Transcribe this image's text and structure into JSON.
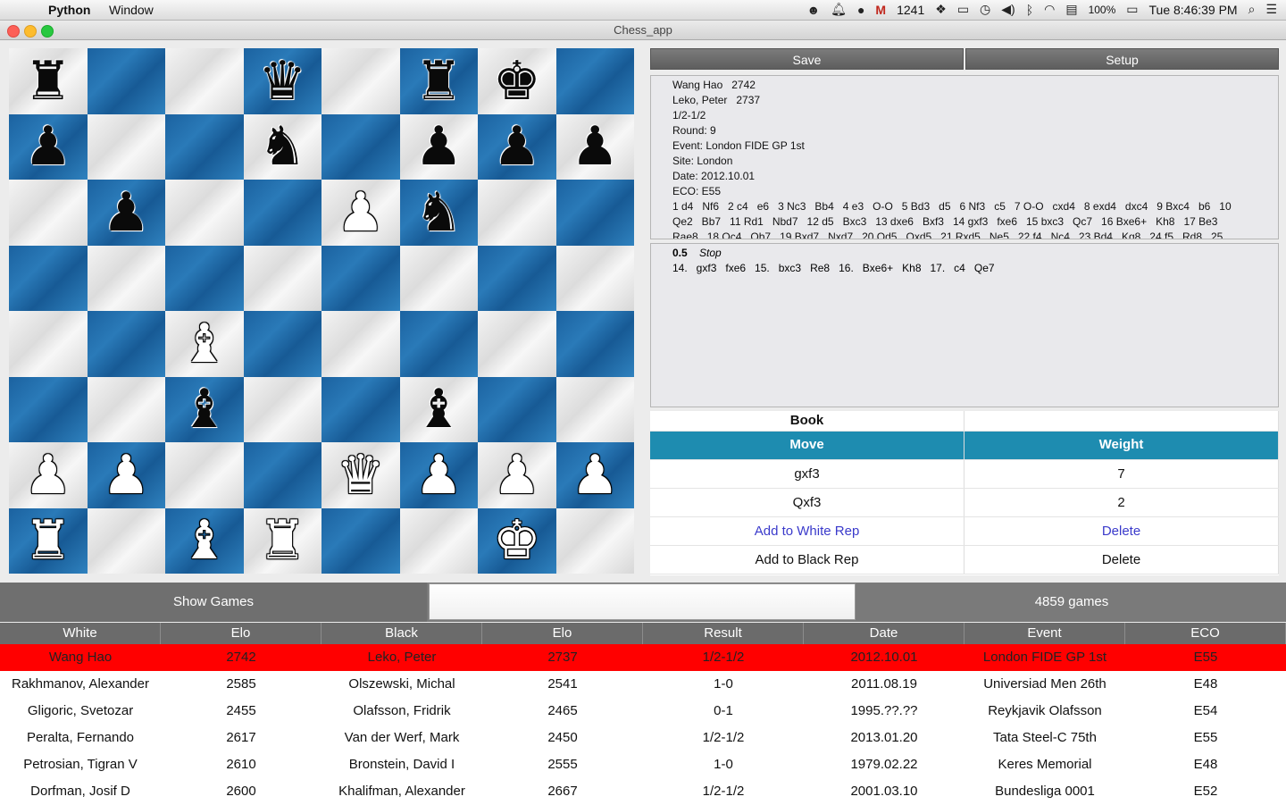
{
  "menubar": {
    "app": "Python",
    "window_menu": "Window",
    "mail_count": "1241",
    "battery": "100%",
    "clock": "Tue 8:46:39 PM"
  },
  "window": {
    "title": "Chess_app"
  },
  "board": {
    "rows": [
      [
        "bR",
        "",
        "",
        "bQ",
        "",
        "bR",
        "bK",
        ""
      ],
      [
        "bP",
        "",
        "",
        "bN",
        "",
        "bP",
        "bP",
        "bP"
      ],
      [
        "",
        "bP",
        "",
        "",
        "wP",
        "bN",
        "",
        ""
      ],
      [
        "",
        "",
        "",
        "",
        "",
        "",
        "",
        ""
      ],
      [
        "",
        "",
        "wB",
        "",
        "",
        "",
        "",
        ""
      ],
      [
        "",
        "",
        "bB",
        "",
        "",
        "bB",
        "",
        ""
      ],
      [
        "wP",
        "wP",
        "",
        "",
        "wQ",
        "wP",
        "wP",
        "wP"
      ],
      [
        "wR",
        "",
        "wB",
        "wR",
        "",
        "",
        "wK",
        ""
      ]
    ]
  },
  "toolbar": {
    "save": "Save",
    "setup": "Setup"
  },
  "game_info": {
    "lines": [
      "Wang Hao   2742",
      "Leko, Peter   2737",
      "1/2-1/2",
      "Round: 9",
      "Event: London FIDE GP 1st",
      "Site: London",
      "Date: 2012.10.01",
      "ECO: E55",
      "1 d4   Nf6   2 c4   e6   3 Nc3   Bb4   4 e3   O-O   5 Bd3   d5   6 Nf3   c5   7 O-O   cxd4   8 exd4   dxc4   9 Bxc4   b6   10",
      "Qe2   Bb7   11 Rd1   Nbd7   12 d5   Bxc3   13 dxe6   Bxf3   14 gxf3   fxe6   15 bxc3   Qc7   16 Bxe6+   Kh8   17 Be3",
      "Rae8   18 Qc4   Qb7   19 Bxd7   Nxd7   20 Qd5   Qxd5   21 Rxd5   Ne5   22 f4   Nc4   23 Bd4   Kg8   24 f5   Rd8   25"
    ]
  },
  "engine": {
    "score": "0.5",
    "stop": "Stop",
    "line": "14.   gxf3   fxe6   15.   bxc3   Re8   16.   Bxe6+   Kh8   17.   c4   Qe7"
  },
  "book": {
    "title": "Book",
    "headers": [
      "Move",
      "Weight"
    ],
    "rows": [
      [
        "gxf3",
        "7"
      ],
      [
        "Qxf3",
        "2"
      ]
    ],
    "add_white": "Add to White Rep",
    "delete_white": "Delete",
    "add_black": "Add to Black Rep",
    "delete_black": "Delete"
  },
  "games_bar": {
    "show_games": "Show Games",
    "search_value": "",
    "count": "4859 games"
  },
  "games_table": {
    "headers": [
      "White",
      "Elo",
      "Black",
      "Elo",
      "Result",
      "Date",
      "Event",
      "ECO"
    ],
    "rows": [
      [
        "Wang Hao",
        "2742",
        "Leko, Peter",
        "2737",
        "1/2-1/2",
        "2012.10.01",
        "London FIDE GP 1st",
        "E55"
      ],
      [
        "Rakhmanov, Alexander",
        "2585",
        "Olszewski, Michal",
        "2541",
        "1-0",
        "2011.08.19",
        "Universiad Men 26th",
        "E48"
      ],
      [
        "Gligoric, Svetozar",
        "2455",
        "Olafsson, Fridrik",
        "2465",
        "0-1",
        "1995.??.??",
        "Reykjavik Olafsson",
        "E54"
      ],
      [
        "Peralta, Fernando",
        "2617",
        "Van der Werf, Mark",
        "2450",
        "1/2-1/2",
        "2013.01.20",
        "Tata Steel-C 75th",
        "E55"
      ],
      [
        "Petrosian, Tigran V",
        "2610",
        "Bronstein, David I",
        "2555",
        "1-0",
        "1979.02.22",
        "Keres Memorial",
        "E48"
      ],
      [
        "Dorfman, Josif D",
        "2600",
        "Khalifman, Alexander",
        "2667",
        "1/2-1/2",
        "2001.03.10",
        "Bundesliga 0001",
        "E52"
      ]
    ]
  },
  "colors": {
    "selected_row": "#ff0000",
    "book_header": "#1e8cb0",
    "board_dark": "#2a7ab8"
  }
}
